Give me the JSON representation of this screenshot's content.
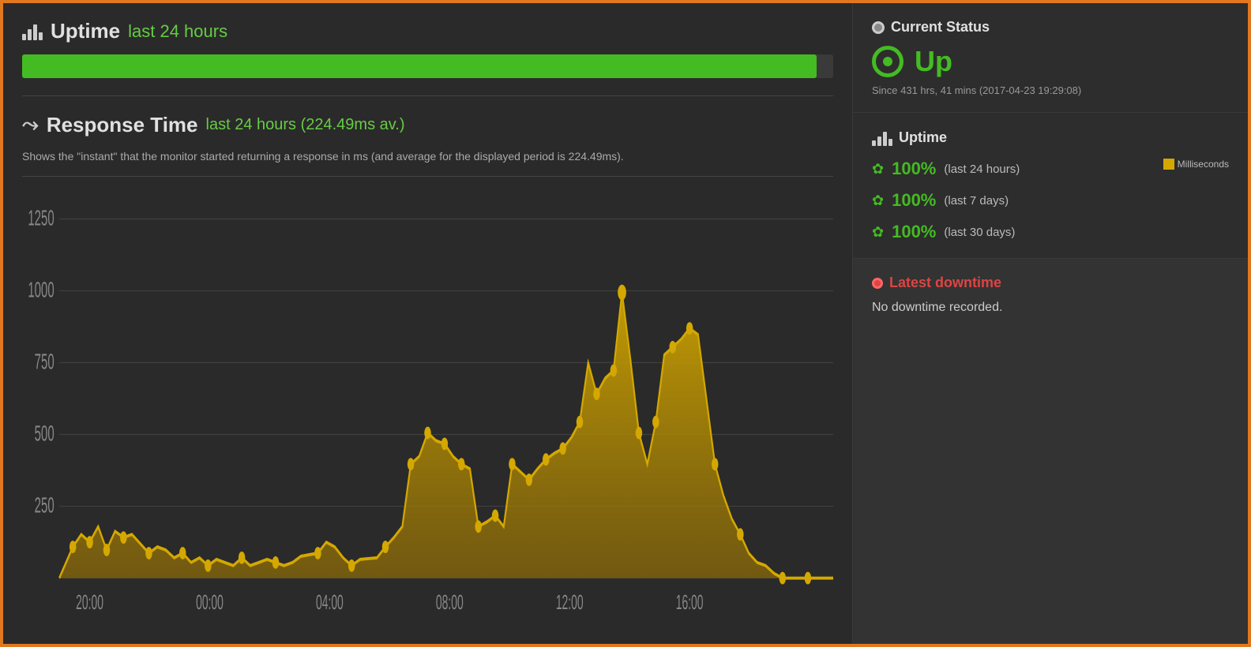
{
  "page": {
    "border_color": "#e07820"
  },
  "left": {
    "uptime_title": "Uptime",
    "uptime_subtitle": "last 24 hours",
    "uptime_bar_width": "98%",
    "response_title": "Response Time",
    "response_subtitle": "last 24 hours (224.49ms av.)",
    "response_desc": "Shows the \"instant\" that the monitor started returning a response in ms (and average for the displayed period is 224.49ms).",
    "chart": {
      "y_labels": [
        "1250",
        "1000",
        "750",
        "500",
        "250",
        ""
      ],
      "x_labels": [
        "20:00",
        "00:00",
        "04:00",
        "08:00",
        "12:00",
        "16:00"
      ],
      "legend": "Milliseconds"
    }
  },
  "right": {
    "current_status_title": "Current Status",
    "status_up_label": "Up",
    "status_since": "Since 431 hrs, 41 mins (2017-04-23 19:29:08)",
    "uptime_section_title": "Uptime",
    "uptime_rows": [
      {
        "pct": "100%",
        "period": "(last 24 hours)",
        "show_legend": true
      },
      {
        "pct": "100%",
        "period": "(last 7 days)",
        "show_legend": false
      },
      {
        "pct": "100%",
        "period": "(last 30 days)",
        "show_legend": false
      }
    ],
    "legend_label": "Milliseconds",
    "latest_downtime_title": "Latest downtime",
    "no_downtime_text": "No downtime recorded."
  }
}
